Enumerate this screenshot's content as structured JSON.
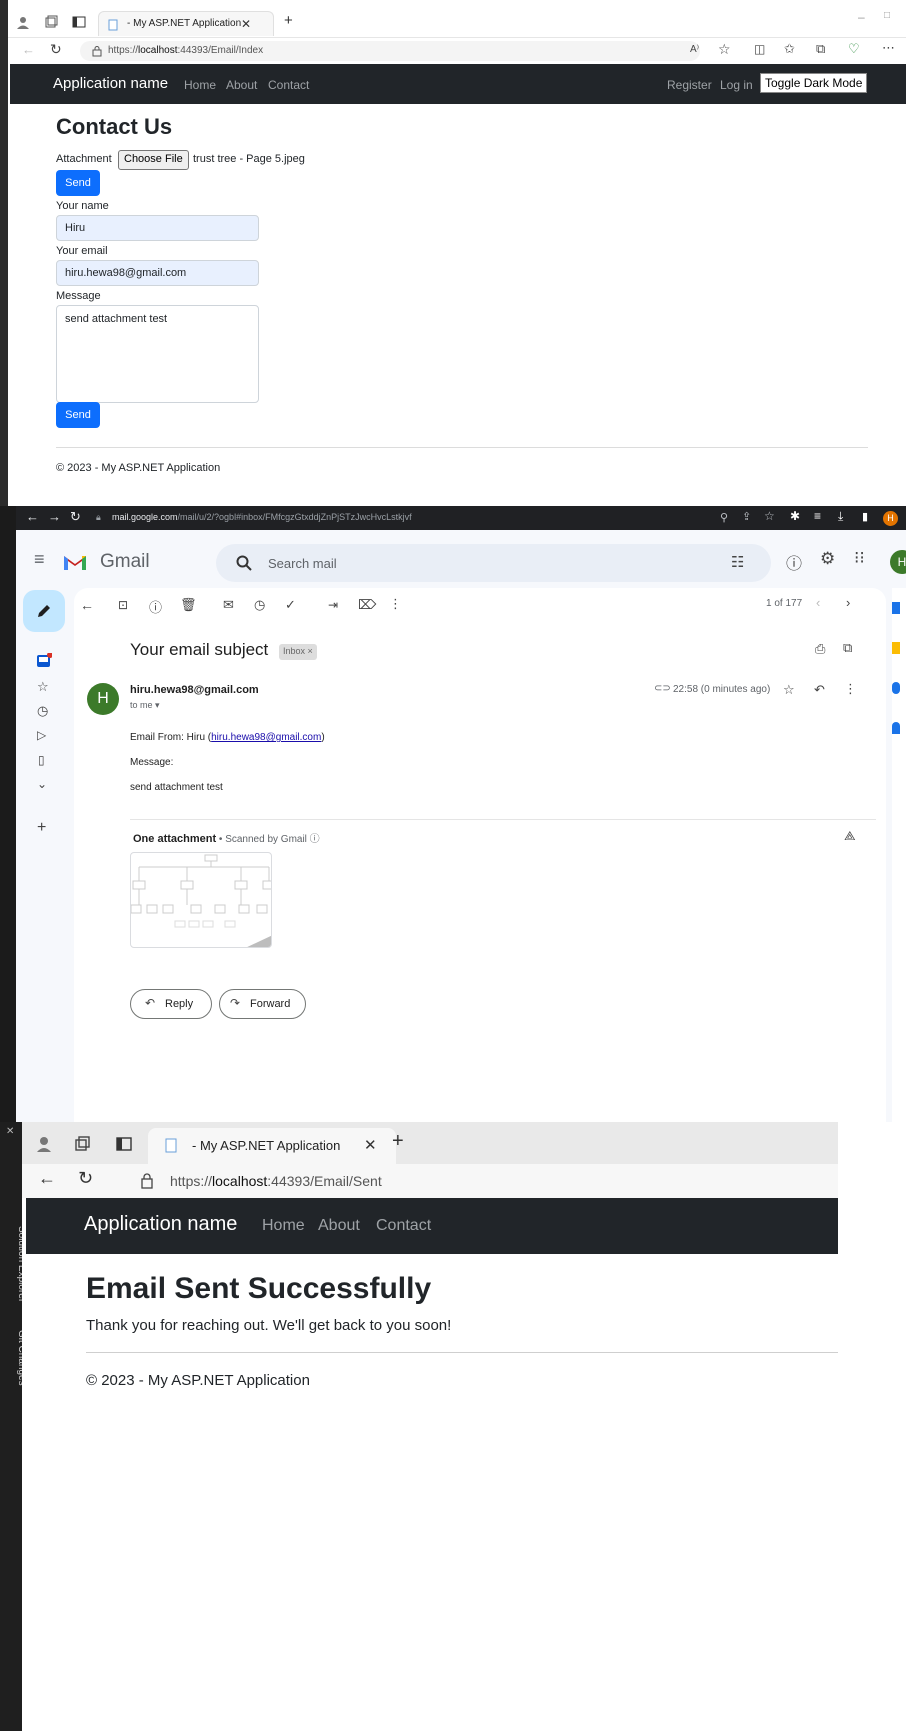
{
  "panel1": {
    "tab_title": "- My ASP.NET Application",
    "url_prefix": "https://",
    "url_host": "localhost",
    "url_rest": ":44393/Email/Index",
    "brand": "Application name",
    "nav": [
      "Home",
      "About",
      "Contact"
    ],
    "register": "Register",
    "login": "Log in",
    "toggle": "Toggle Dark Mode",
    "heading": "Contact Us",
    "attachment_label": "Attachment",
    "choose_file": "Choose File",
    "file_name": "trust tree - Page 5.jpeg",
    "send": "Send",
    "name_label": "Your name",
    "name_value": "Hiru",
    "email_label": "Your email",
    "email_value": "hiru.hewa98@gmail.com",
    "message_label": "Message",
    "message_value": "send attachment test",
    "footer": "© 2023 - My ASP.NET Application"
  },
  "panel2": {
    "url_host": "mail.google.com",
    "url_rest": "/mail/u/2/?ogbl#inbox/FMfcgzGtxddjZnPjSTzJwcHvcLstkjvf",
    "gmail": "Gmail",
    "search_placeholder": "Search mail",
    "counter": "1 of 177",
    "subject": "Your email subject",
    "inbox_badge": "Inbox ×",
    "avatar_letter": "H",
    "sender": "hiru.hewa98@gmail.com",
    "to_me": "to me ▾",
    "time": "22:58 (0 minutes ago)",
    "body_from_prefix": "Email From: Hiru (",
    "body_from_link": "hiru.hewa98@gmail.com",
    "body_from_suffix": ")",
    "body_message_label": "Message:",
    "body_message": "send attachment test",
    "attach_title": "One attachment",
    "attach_scanned": " • Scanned by Gmail ⓘ",
    "reply": "Reply",
    "forward": "Forward",
    "profile_letter": "H"
  },
  "panel3": {
    "tab_title": "- My ASP.NET Application",
    "url_prefix": "https://",
    "url_host": "localhost",
    "url_rest": ":44393/Email/Sent",
    "brand": "Application name",
    "nav": [
      "Home",
      "About",
      "Contact"
    ],
    "heading": "Email Sent Successfully",
    "message": "Thank you for reaching out. We'll get back to you soon!",
    "footer": "© 2023 - My ASP.NET Application"
  },
  "vs_strip": {
    "solution_explorer": "Solution Explorer",
    "git_changes": "Git Changes"
  },
  "colors": {
    "navbar": "#212529",
    "primary": "#0d6efd",
    "gmail_avatar": "#3c7a2a",
    "compose": "#c2e7ff"
  }
}
